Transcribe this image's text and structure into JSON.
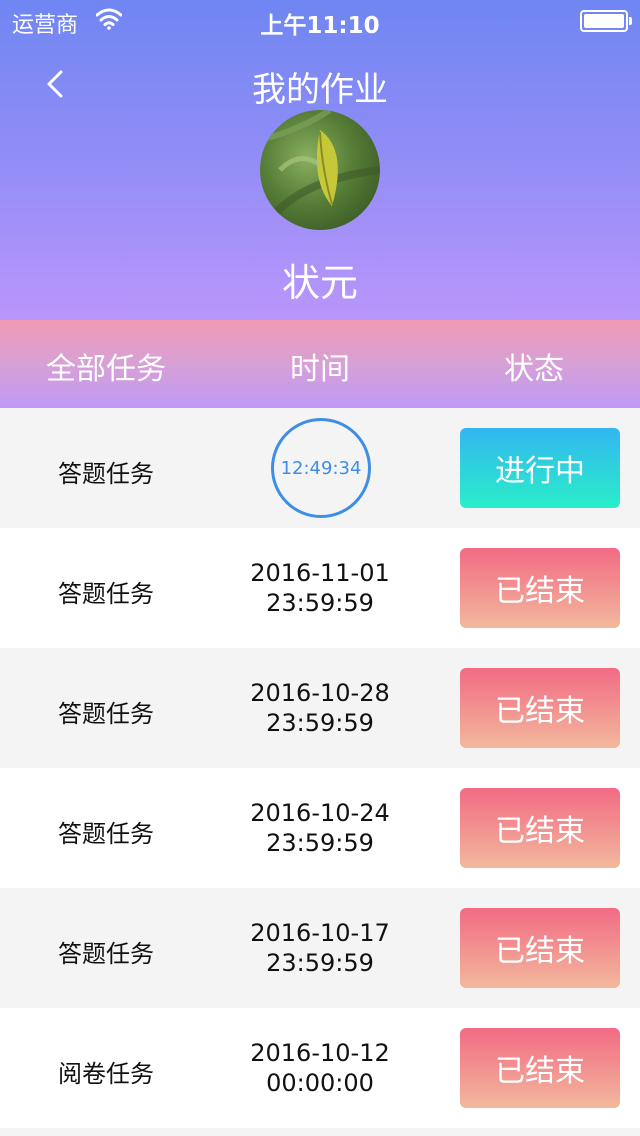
{
  "status_bar": {
    "carrier": "运营商",
    "time": "上午11:10"
  },
  "header": {
    "title": "我的作业",
    "username": "状元"
  },
  "tabs": {
    "all": "全部任务",
    "time": "时间",
    "status": "状态"
  },
  "rows": [
    {
      "task": "答题任务",
      "timer": "12:49:34",
      "status": "进行中"
    },
    {
      "task": "答题任务",
      "date": "2016-11-01",
      "clock": "23:59:59",
      "status": "已结束"
    },
    {
      "task": "答题任务",
      "date": "2016-10-28",
      "clock": "23:59:59",
      "status": "已结束"
    },
    {
      "task": "答题任务",
      "date": "2016-10-24",
      "clock": "23:59:59",
      "status": "已结束"
    },
    {
      "task": "答题任务",
      "date": "2016-10-17",
      "clock": "23:59:59",
      "status": "已结束"
    },
    {
      "task": "阅卷任务",
      "date": "2016-10-12",
      "clock": "00:00:00",
      "status": "已结束"
    }
  ],
  "colors": {
    "header_top": "#6f86f2",
    "header_bottom": "#b996fb",
    "active_status": "#2fd6e0",
    "ended_status": "#f28a90",
    "timer_ring": "#3e8ee6"
  }
}
